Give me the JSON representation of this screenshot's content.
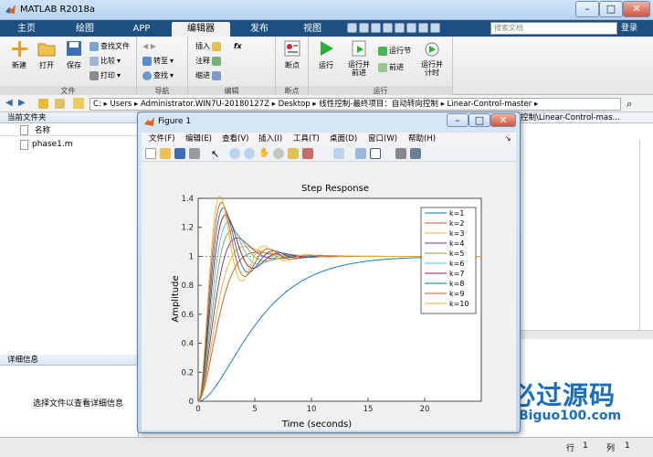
{
  "window": {
    "title": "MATLAB R2018a"
  },
  "tabs": [
    "主页",
    "绘图",
    "APP",
    "编辑器",
    "发布",
    "视图"
  ],
  "active_tab": 3,
  "search": {
    "placeholder": "搜索文档"
  },
  "login": "登录",
  "toolstrip": {
    "file": {
      "label": "文件",
      "new": "新建",
      "open": "打开",
      "save": "保存",
      "find_files": "查找文件",
      "compare": "比较",
      "print": "打印"
    },
    "nav": {
      "label": "导航",
      "goto": "转至",
      "find": "查找"
    },
    "edit": {
      "label": "编辑",
      "insert": "插入",
      "comment": "注释",
      "indent": "缩进",
      "fx": "fx"
    },
    "breakpoints": {
      "label": "断点",
      "button": "断点"
    },
    "run": {
      "label": "运行",
      "run": "运行",
      "run_advance": "运行并\n前进",
      "run_section": "运行节",
      "advance": "前进",
      "run_time": "运行并\n计时"
    }
  },
  "address": {
    "drive": "C:",
    "segments": [
      "Users",
      "Administrator.WIN7U-20180127Z",
      "Desktop",
      "线性控制-最终项目：自动转向控制",
      "Linear-Control-master"
    ]
  },
  "left_panel": {
    "title": "当前文件夹",
    "col": "名称",
    "files": [
      "phase1.m"
    ]
  },
  "detail_panel": {
    "title": "详细信息",
    "text": "选择文件以查看详细信息"
  },
  "right_path": "控制\\Linear-Control-mas...",
  "status": {
    "row_label": "行",
    "row": "1",
    "col_label": "列",
    "col": "1"
  },
  "figure": {
    "title": "Figure 1",
    "menu": [
      "文件(F)",
      "编辑(E)",
      "查看(V)",
      "插入(I)",
      "工具(T)",
      "桌面(D)",
      "窗口(W)",
      "帮助(H)"
    ]
  },
  "watermark": {
    "name": "必过源码",
    "url": "Biguo100.com"
  },
  "chart_data": {
    "type": "line",
    "title": "Step Response",
    "xlabel": "Time (seconds)",
    "ylabel": "Amplitude",
    "xlim": [
      0,
      25
    ],
    "ylim": [
      0,
      1.4
    ],
    "xticks": [
      0,
      5,
      10,
      15,
      20
    ],
    "yticks": [
      0,
      0.2,
      0.4,
      0.6,
      0.8,
      1,
      1.2,
      1.4
    ],
    "legend_position": "top-right",
    "reference_line": 1,
    "series": [
      {
        "name": "k=1",
        "color": "#0072BD",
        "wn": 0.35,
        "zeta": 1.0
      },
      {
        "name": "k=2",
        "color": "#D95319",
        "wn": 0.9,
        "zeta": 0.75
      },
      {
        "name": "k=3",
        "color": "#EDB120",
        "wn": 1.0,
        "zeta": 0.65
      },
      {
        "name": "k=4",
        "color": "#7E2F8E",
        "wn": 1.1,
        "zeta": 0.55
      },
      {
        "name": "k=5",
        "color": "#77AC30",
        "wn": 1.2,
        "zeta": 0.48
      },
      {
        "name": "k=6",
        "color": "#4DBEEE",
        "wn": 1.3,
        "zeta": 0.42
      },
      {
        "name": "k=7",
        "color": "#A2142F",
        "wn": 1.4,
        "zeta": 0.37
      },
      {
        "name": "k=8",
        "color": "#0072BD",
        "wn": 1.5,
        "zeta": 0.33
      },
      {
        "name": "k=9",
        "color": "#D95319",
        "wn": 1.6,
        "zeta": 0.3
      },
      {
        "name": "k=10",
        "color": "#EDB120",
        "wn": 1.7,
        "zeta": 0.27
      }
    ]
  }
}
